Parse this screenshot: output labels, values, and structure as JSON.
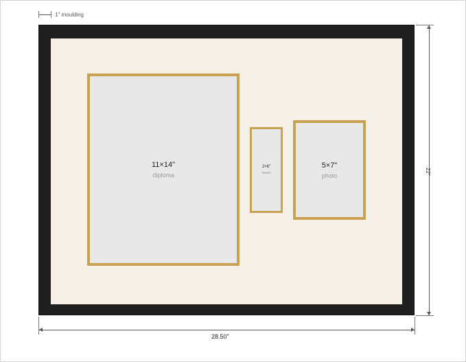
{
  "dimensions": {
    "moulding_label": "1\" moulding",
    "width_label": "28.50\"",
    "height_label": "22\""
  },
  "openings": {
    "diploma": {
      "size": "11×14\"",
      "name": "diploma"
    },
    "tassel": {
      "size": "2×6\"",
      "name": "tassel"
    },
    "photo": {
      "size": "5×7\"",
      "name": "photo"
    }
  },
  "colors": {
    "frame": "#1f1f1f",
    "mat": "#f4f0e8",
    "opening_fill": "#e8e8e8",
    "gold_trim": "#c8a250"
  }
}
